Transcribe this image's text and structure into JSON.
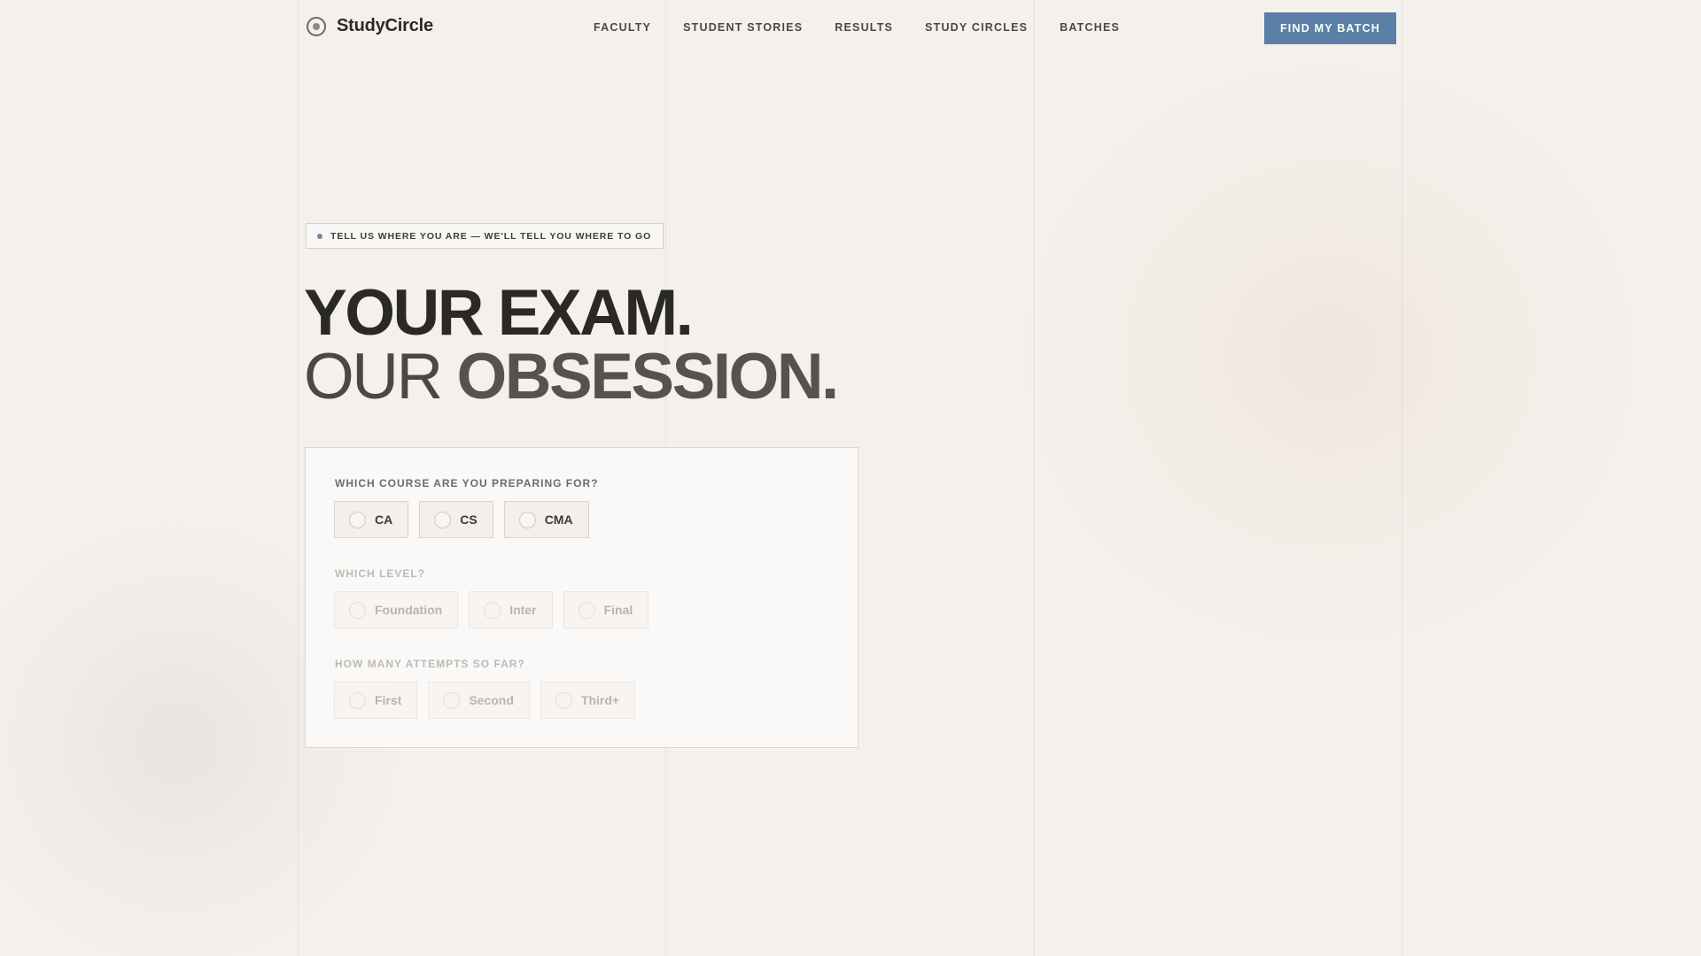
{
  "brand": {
    "name": "StudyCircle",
    "logo_icon": "circle-logo-icon"
  },
  "nav": {
    "items": [
      {
        "label": "FACULTY"
      },
      {
        "label": "STUDENT STORIES"
      },
      {
        "label": "RESULTS"
      },
      {
        "label": "STUDY CIRCLES"
      },
      {
        "label": "BATCHES"
      }
    ],
    "cta_label": "FIND MY BATCH"
  },
  "hero": {
    "eyebrow": "TELL US WHERE YOU ARE — WE'LL TELL YOU WHERE TO GO",
    "line1": "YOUR EXAM.",
    "line2_light": "OUR",
    "line2_bold": "OBSESSION."
  },
  "quiz": {
    "course": {
      "label": "WHICH COURSE ARE YOU PREPARING FOR?",
      "options": [
        "CA",
        "CS",
        "CMA"
      ]
    },
    "level": {
      "label": "WHICH LEVEL?",
      "options": [
        "Foundation",
        "Inter",
        "Final"
      ]
    },
    "attempts": {
      "label": "HOW MANY ATTEMPTS SO FAR?",
      "options": [
        "First",
        "Second",
        "Third+"
      ]
    }
  },
  "colors": {
    "accent": "#5b7fa6",
    "background": "#f4f0ec",
    "text": "#2b2a28"
  }
}
